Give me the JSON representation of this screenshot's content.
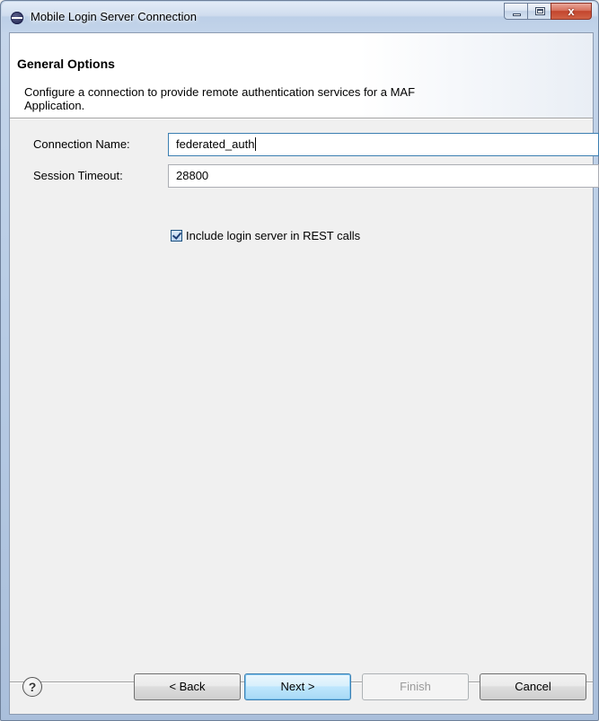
{
  "window": {
    "title": "Mobile Login Server Connection",
    "close_glyph": "x"
  },
  "banner": {
    "title": "General Options",
    "description": "Configure a connection to provide remote authentication services for a MAF Application."
  },
  "form": {
    "connection_name_label": "Connection Name:",
    "connection_name_value": "federated_auth",
    "session_timeout_label": "Session Timeout:",
    "session_timeout_value": "28800",
    "include_login_label": "Include login server in REST calls",
    "include_login_checked": true
  },
  "buttons": {
    "help": "?",
    "back": "< Back",
    "next": "Next >",
    "finish": "Finish",
    "cancel": "Cancel"
  },
  "icons": {
    "app": "eclipse-icon",
    "help": "help-icon",
    "checkbox": "checkmark-icon"
  }
}
